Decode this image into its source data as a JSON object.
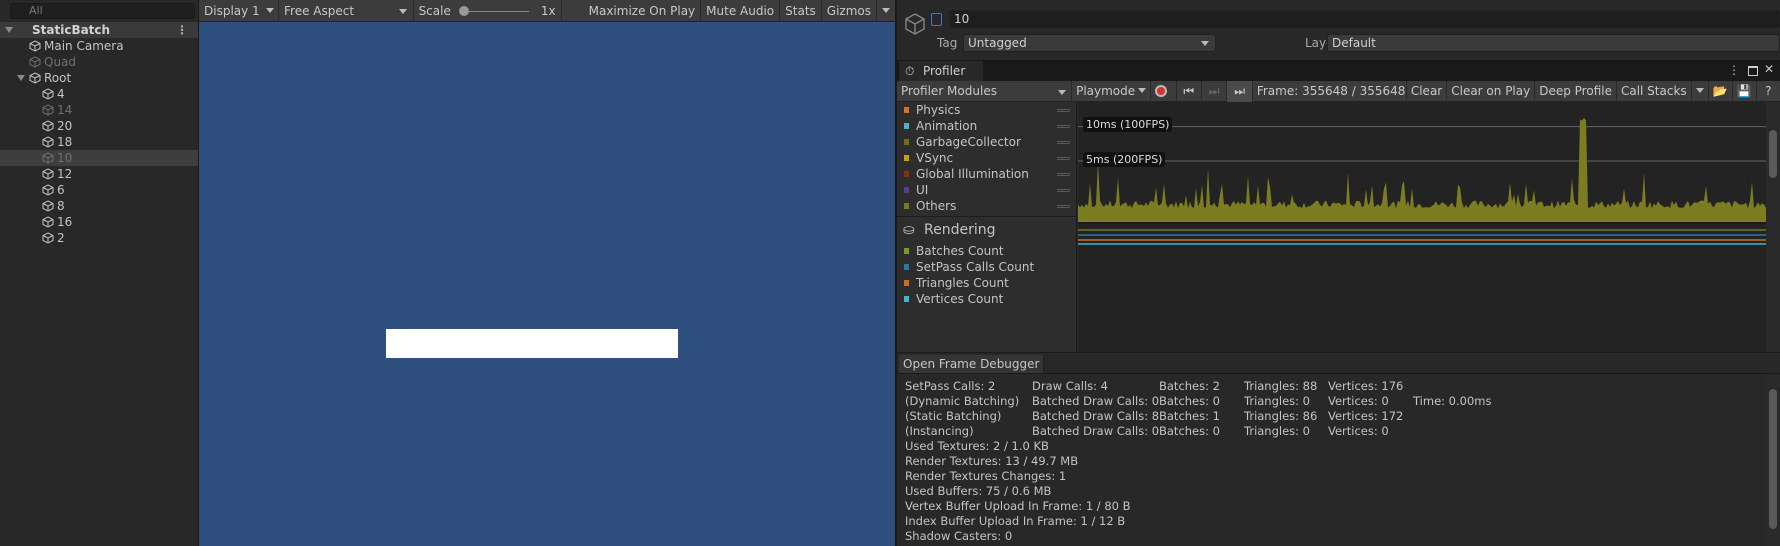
{
  "hierarchy": {
    "search_placeholder": "All",
    "scene": "StaticBatch",
    "items": [
      {
        "label": "Main Camera",
        "depth": 1,
        "dim": false
      },
      {
        "label": "Quad",
        "depth": 1,
        "dim": true
      },
      {
        "label": "Root",
        "depth": 1,
        "dim": false,
        "expanded": true
      },
      {
        "label": "4",
        "depth": 2,
        "dim": false
      },
      {
        "label": "14",
        "depth": 2,
        "dim": true
      },
      {
        "label": "20",
        "depth": 2,
        "dim": false
      },
      {
        "label": "18",
        "depth": 2,
        "dim": false
      },
      {
        "label": "10",
        "depth": 2,
        "dim": true,
        "selected": true
      },
      {
        "label": "12",
        "depth": 2,
        "dim": false
      },
      {
        "label": "6",
        "depth": 2,
        "dim": false
      },
      {
        "label": "8",
        "depth": 2,
        "dim": false
      },
      {
        "label": "16",
        "depth": 2,
        "dim": false
      },
      {
        "label": "2",
        "depth": 2,
        "dim": false
      }
    ]
  },
  "game": {
    "display": "Display 1",
    "aspect": "Free Aspect",
    "scale_label": "Scale",
    "scale_value": "1x",
    "maximize": "Maximize On Play",
    "mute": "Mute Audio",
    "stats": "Stats",
    "gizmos": "Gizmos",
    "background": "#2f4f7f"
  },
  "inspector": {
    "name": "10",
    "active": false,
    "tag_label": "Tag",
    "tag": "Untagged",
    "layer_label": "Layer",
    "layer": "Default"
  },
  "profiler": {
    "tab": "Profiler",
    "modules": "Profiler Modules",
    "playmode": "Playmode",
    "frame": "Frame: 355648 / 355648",
    "clear": "Clear",
    "clear_on_play": "Clear on Play",
    "deep_profile": "Deep Profile",
    "call_stacks": "Call Stacks",
    "cpu_items": [
      {
        "label": "Physics",
        "color": "#d2731e"
      },
      {
        "label": "Animation",
        "color": "#3fb7c9"
      },
      {
        "label": "GarbageCollector",
        "color": "#6f6f18"
      },
      {
        "label": "VSync",
        "color": "#c8a00c"
      },
      {
        "label": "Global Illumination",
        "color": "#8c2a12"
      },
      {
        "label": "UI",
        "color": "#5a3c8c"
      },
      {
        "label": "Others",
        "color": "#7a7a1c"
      }
    ],
    "lines": [
      "10ms (100FPS)",
      "5ms (200FPS)"
    ],
    "rendering_title": "Rendering",
    "render_items": [
      {
        "label": "Batches Count",
        "color": "#7a9a1c"
      },
      {
        "label": "SetPass Calls Count",
        "color": "#2a78a8"
      },
      {
        "label": "Triangles Count",
        "color": "#c8701e"
      },
      {
        "label": "Vertices Count",
        "color": "#3fb7c9"
      }
    ],
    "open_frame_debugger": "Open Frame Debugger",
    "stats_grid": [
      [
        "SetPass Calls: 2",
        "Draw Calls: 4",
        "Batches: 2",
        "Triangles: 88",
        "Vertices: 176",
        ""
      ],
      [
        "(Dynamic Batching)",
        "Batched Draw Calls: 0",
        "Batches: 0",
        "Triangles: 0",
        "Vertices: 0",
        "Time: 0.00ms"
      ],
      [
        "(Static Batching)",
        "Batched Draw Calls: 8",
        "Batches: 1",
        "Triangles: 86",
        "Vertices: 172",
        ""
      ],
      [
        "(Instancing)",
        "Batched Draw Calls: 0",
        "Batches: 0",
        "Triangles: 0",
        "Vertices: 0",
        ""
      ]
    ],
    "stats_lines": [
      "Used Textures: 2 / 1.0 KB",
      "Render Textures: 13 / 49.7 MB",
      "Render Textures Changes: 1",
      "Used Buffers: 75 / 0.6 MB",
      "Vertex Buffer Upload In Frame: 1 / 80 B",
      "Index Buffer Upload In Frame: 1 / 12 B",
      "Shadow Casters: 0"
    ]
  }
}
